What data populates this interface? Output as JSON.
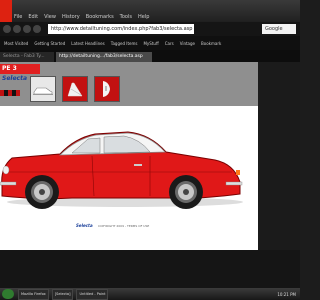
{
  "browser": {
    "menu_items": [
      "File",
      "Edit",
      "View",
      "History",
      "Bookmarks",
      "Tools",
      "Help"
    ],
    "address_url": "http://www.detailtuning.com/index.php?fab3/selecta.asp",
    "search_placeholder": "Google",
    "bookmarks": [
      "Most Visited",
      "Getting Started",
      "Latest Headlines",
      "Tagged Items",
      "MyStuff",
      "Cars",
      "Vintage",
      "Bookmark"
    ],
    "tabs": [
      {
        "label": "Selecta - Fab3 Ty...",
        "active": false
      },
      {
        "label": "http://detailtuning.../fab3/selecta.asp",
        "active": true
      }
    ]
  },
  "page": {
    "brand_prefix": "PE 3",
    "brand_name": "Selecta",
    "footer_logo": "Selecta",
    "copyright": "COPYRIGHT 2009 - TERMS OF USE",
    "colors": {
      "car_body": "#e01818",
      "car_roof": "#f5f5f5",
      "accent": "#1a3f9a"
    },
    "swatches": [
      "#c01010",
      "#111111",
      "#c01010",
      "#111111",
      "#c01010"
    ]
  },
  "taskbar": {
    "tasks": [
      "Mozilla Firefox",
      "[Selecta]",
      "Untitled - Paint"
    ],
    "clock": "10:21 PM"
  }
}
